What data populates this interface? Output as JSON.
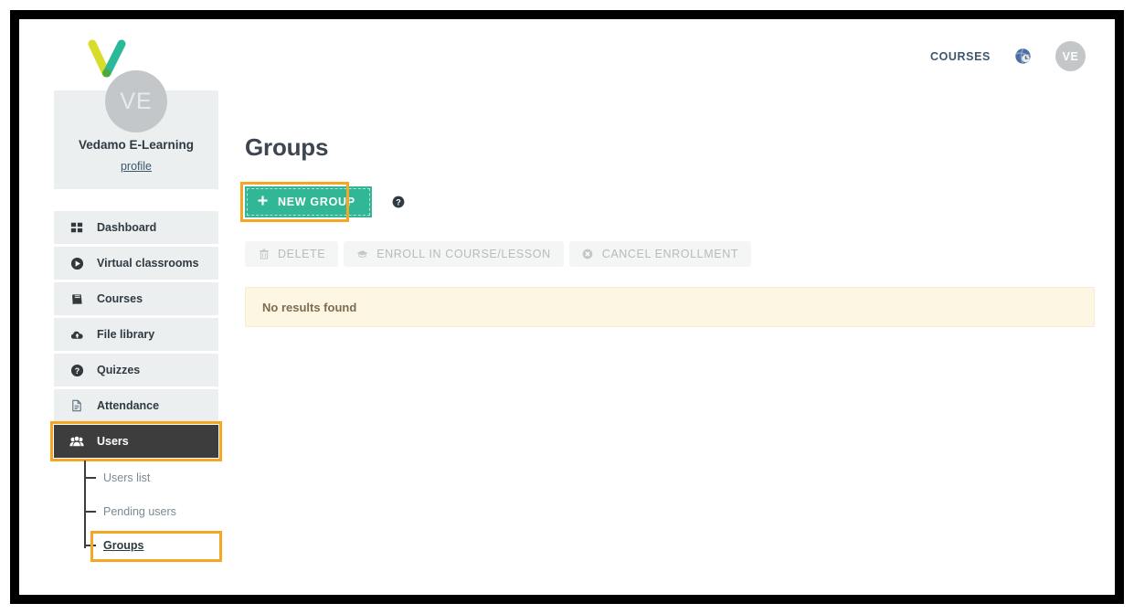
{
  "header": {
    "logo_name": "vedamo-v-logo",
    "courses_label": "COURSES",
    "globe_icon": "globe-icon",
    "avatar_initials": "VE"
  },
  "sidebar": {
    "profile": {
      "avatar_initials": "VE",
      "name": "Vedamo E-Learning",
      "profile_link": "profile"
    },
    "items": [
      {
        "label": "Dashboard",
        "icon": "grid-icon",
        "active": false
      },
      {
        "label": "Virtual classrooms",
        "icon": "play-circle-icon",
        "active": false
      },
      {
        "label": "Courses",
        "icon": "book-icon",
        "active": false
      },
      {
        "label": "File library",
        "icon": "cloud-upload-icon",
        "active": false
      },
      {
        "label": "Quizzes",
        "icon": "question-circle-icon",
        "active": false
      },
      {
        "label": "Attendance",
        "icon": "document-icon",
        "active": false
      },
      {
        "label": "Users",
        "icon": "users-group-icon",
        "active": true
      }
    ],
    "subitems": [
      {
        "label": "Users list",
        "active": false
      },
      {
        "label": "Pending users",
        "active": false
      },
      {
        "label": "Groups",
        "active": true
      }
    ]
  },
  "main": {
    "page_title": "Groups",
    "new_group_label": "NEW GROUP",
    "new_group_icon": "plus-icon",
    "help_icon": "question-mark-icon",
    "toolbar": [
      {
        "label": "DELETE",
        "icon": "trash-icon",
        "disabled": true
      },
      {
        "label": "ENROLL IN COURSE/LESSON",
        "icon": "graduation-cap-icon",
        "disabled": true
      },
      {
        "label": "CANCEL ENROLLMENT",
        "icon": "cancel-circle-icon",
        "disabled": true
      }
    ],
    "alert_text": "No results found"
  },
  "colors": {
    "accent_teal": "#32b796",
    "highlight_orange": "#f5a623",
    "sidebar_grey": "#eceff0",
    "active_dark": "#3d3d3d",
    "alert_bg": "#fdf6e3",
    "alert_text": "#7d6b4f",
    "link_blue": "#3d566e"
  }
}
